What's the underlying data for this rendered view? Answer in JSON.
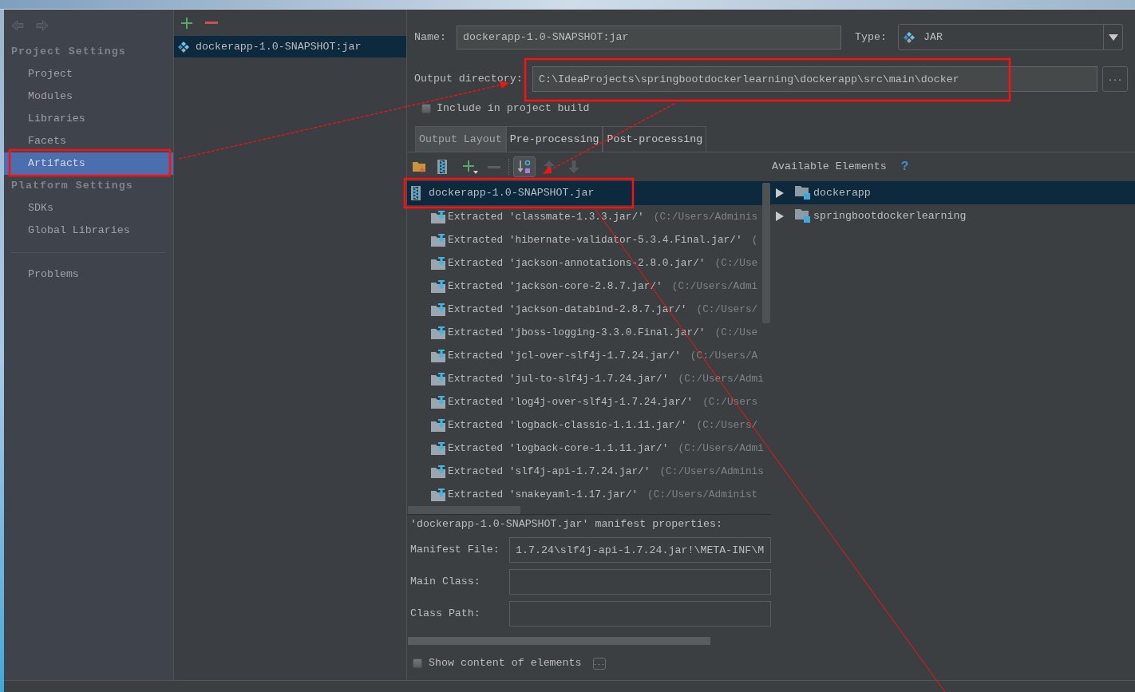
{
  "sidebar": {
    "history": [
      {
        "kind": "back",
        "disabled": true
      },
      {
        "kind": "forward",
        "disabled": true
      }
    ],
    "sections": [
      {
        "title": "Project Settings",
        "items": [
          {
            "label": "Project",
            "selected": false
          },
          {
            "label": "Modules",
            "selected": false
          },
          {
            "label": "Libraries",
            "selected": false
          },
          {
            "label": "Facets",
            "selected": false
          },
          {
            "label": "Artifacts",
            "selected": true
          }
        ]
      },
      {
        "title": "Platform Settings",
        "items": [
          {
            "label": "SDKs",
            "selected": false
          },
          {
            "label": "Global Libraries",
            "selected": false
          }
        ]
      },
      {
        "items": [
          {
            "label": "Problems",
            "selected": false
          }
        ]
      }
    ]
  },
  "artifacts": {
    "toolbar": [
      {
        "kind": "add",
        "disabled": false
      },
      {
        "kind": "remove",
        "disabled": false
      }
    ],
    "items": [
      {
        "label": "dockerapp-1.0-SNAPSHOT:jar",
        "selected": true
      }
    ]
  },
  "editor": {
    "name": {
      "label": "Name:",
      "value": "dockerapp-1.0-SNAPSHOT:jar"
    },
    "type": {
      "label": "Type:",
      "value": "JAR"
    },
    "output_directory": {
      "label": "Output directory:",
      "value": "C:\\IdeaProjects\\springbootdockerlearning\\dockerapp\\src\\main\\docker",
      "button": "..."
    },
    "include_in_build": {
      "label": "Include in project build",
      "checked": false
    },
    "tabs": [
      {
        "label": "Output Layout",
        "selected": true
      },
      {
        "label": "Pre-processing",
        "selected": false
      },
      {
        "label": "Post-processing",
        "selected": false
      }
    ],
    "layout_toolbar": [
      {
        "kind": "new-folder",
        "disabled": false
      },
      {
        "kind": "archive",
        "disabled": false
      },
      {
        "kind": "add-menu",
        "disabled": false
      },
      {
        "kind": "remove",
        "disabled": true
      },
      {
        "kind": "separator"
      },
      {
        "kind": "sort",
        "disabled": false,
        "on": true
      },
      {
        "kind": "up",
        "disabled": true
      },
      {
        "kind": "down",
        "disabled": true
      }
    ],
    "output_layout": {
      "label": "dockerapp-1.0-SNAPSHOT.jar",
      "selected": true,
      "children": [
        {
          "label": "Extracted 'classmate-1.3.3.jar/'",
          "location": "(C:/Users/Adminis",
          "selected": false
        },
        {
          "label": "Extracted 'hibernate-validator-5.3.4.Final.jar/'",
          "location": "(",
          "selected": false
        },
        {
          "label": "Extracted 'jackson-annotations-2.8.0.jar/'",
          "location": "(C:/Use",
          "selected": false
        },
        {
          "label": "Extracted 'jackson-core-2.8.7.jar/'",
          "location": "(C:/Users/Admi",
          "selected": false
        },
        {
          "label": "Extracted 'jackson-databind-2.8.7.jar/'",
          "location": "(C:/Users/",
          "selected": false
        },
        {
          "label": "Extracted 'jboss-logging-3.3.0.Final.jar/'",
          "location": "(C:/Use",
          "selected": false
        },
        {
          "label": "Extracted 'jcl-over-slf4j-1.7.24.jar/'",
          "location": "(C:/Users/A",
          "selected": false
        },
        {
          "label": "Extracted 'jul-to-slf4j-1.7.24.jar/'",
          "location": "(C:/Users/Admi",
          "selected": false
        },
        {
          "label": "Extracted 'log4j-over-slf4j-1.7.24.jar/'",
          "location": "(C:/Users",
          "selected": false
        },
        {
          "label": "Extracted 'logback-classic-1.1.11.jar/'",
          "location": "(C:/Users/",
          "selected": false
        },
        {
          "label": "Extracted 'logback-core-1.1.11.jar/'",
          "location": "(C:/Users/Admi",
          "selected": false
        },
        {
          "label": "Extracted 'slf4j-api-1.7.24.jar/'",
          "location": "(C:/Users/Adminis",
          "selected": false
        },
        {
          "label": "Extracted 'snakeyaml-1.17.jar/'",
          "location": "(C:/Users/Administ",
          "selected": false
        }
      ]
    },
    "available_elements": {
      "title": "Available Elements",
      "help": "?",
      "items": [
        {
          "label": "dockerapp",
          "selected": true,
          "expanded": false
        },
        {
          "label": "springbootdockerlearning",
          "selected": false,
          "expanded": false
        }
      ]
    },
    "manifest": {
      "title": "'dockerapp-1.0-SNAPSHOT.jar' manifest properties:",
      "fields": [
        {
          "label": "Manifest File:",
          "value": "1.7.24\\slf4j-api-1.7.24.jar!\\META-INF\\M"
        },
        {
          "label": "Main Class:"
        },
        {
          "label": "Class Path:"
        }
      ]
    },
    "show_content": {
      "label": "Show content of elements",
      "checked": false,
      "button": "..."
    }
  },
  "annotations": [
    {
      "kind": "frame"
    },
    {
      "kind": "frame"
    },
    {
      "kind": "frame"
    },
    {
      "kind": "arrow"
    },
    {
      "kind": "arrow"
    },
    {
      "kind": "line"
    }
  ]
}
